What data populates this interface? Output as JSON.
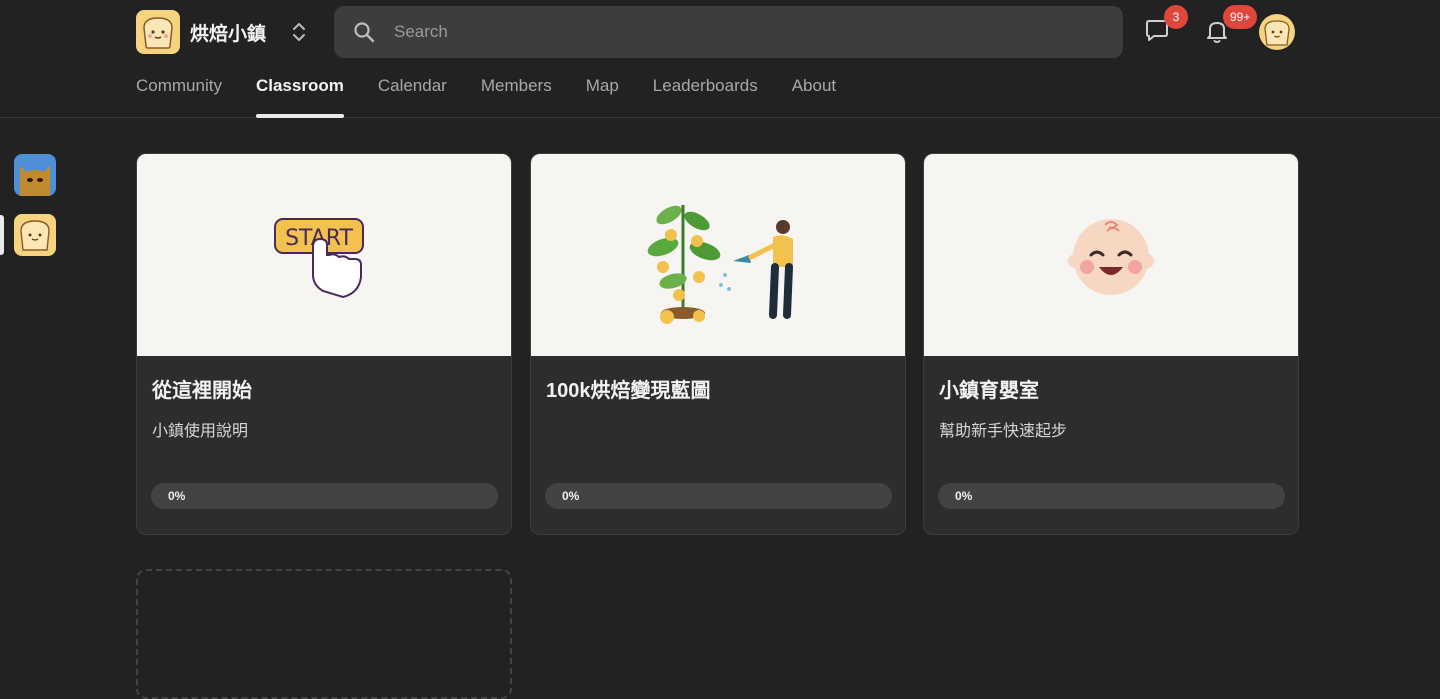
{
  "header": {
    "brand_name": "烘焙小鎮",
    "search_placeholder": "Search",
    "chat_badge": "3",
    "notifications_badge": "99+"
  },
  "nav": {
    "tabs": [
      {
        "label": "Community",
        "active": false
      },
      {
        "label": "Classroom",
        "active": true
      },
      {
        "label": "Calendar",
        "active": false
      },
      {
        "label": "Members",
        "active": false
      },
      {
        "label": "Map",
        "active": false
      },
      {
        "label": "Leaderboards",
        "active": false
      },
      {
        "label": "About",
        "active": false
      }
    ]
  },
  "courses": [
    {
      "title": "從這裡開始",
      "description": "小鎮使用說明",
      "progress_label": "0%",
      "progress": 0,
      "cover_text": "START"
    },
    {
      "title": "100k烘焙變現藍圖",
      "description": "",
      "progress_label": "0%",
      "progress": 0
    },
    {
      "title": "小鎮育嬰室",
      "description": "幫助新手快速起步",
      "progress_label": "0%",
      "progress": 0
    }
  ],
  "colors": {
    "background": "#222222",
    "card": "#2d2d2d",
    "badge": "#e0463c",
    "cover": "#f6f5f2"
  }
}
